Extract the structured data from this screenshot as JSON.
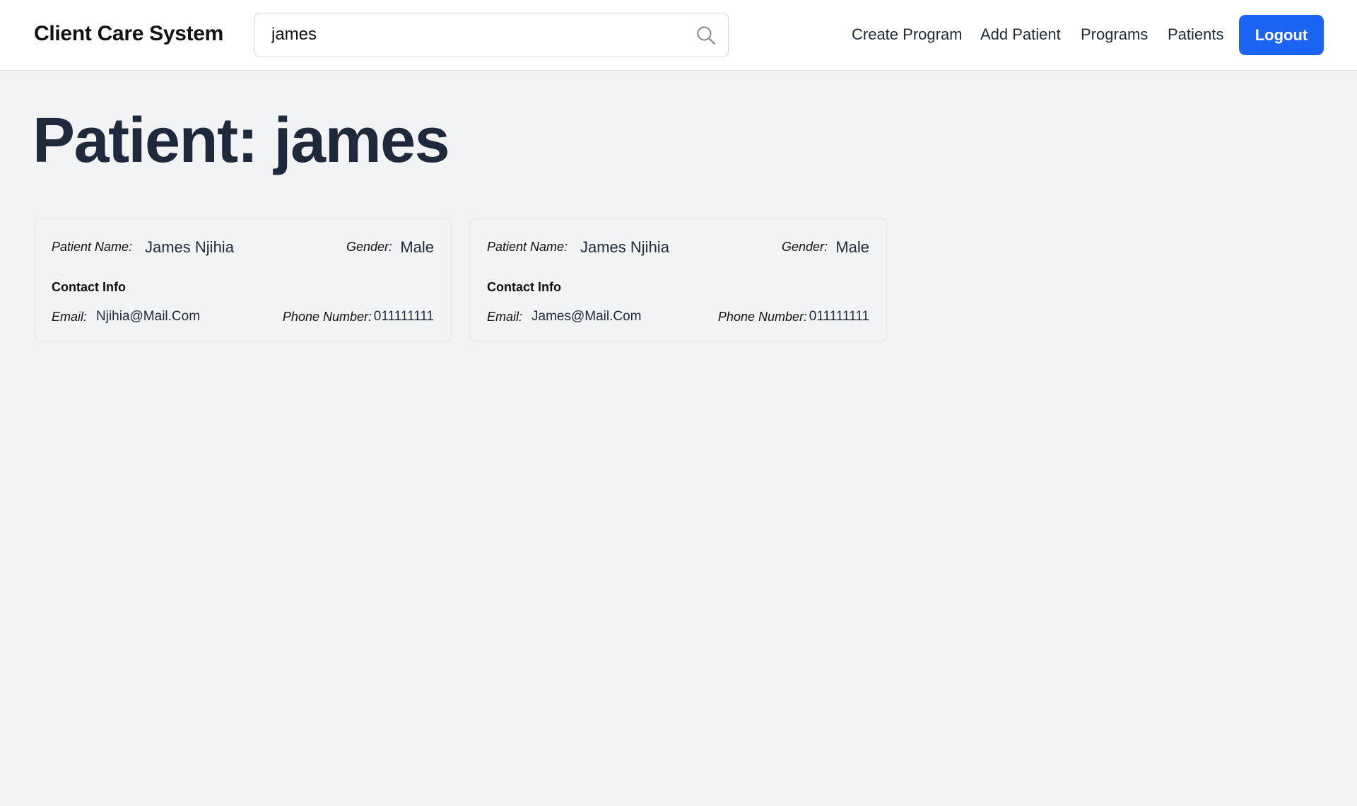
{
  "app": {
    "title": "Client Care System"
  },
  "search": {
    "value": "james",
    "icon": "search-icon"
  },
  "nav": {
    "create_program": "Create Program",
    "add_patient": "Add Patient",
    "programs": "Programs",
    "patients": "Patients",
    "logout": "Logout"
  },
  "colors": {
    "accent": "#1a63f5",
    "background": "#f2f3f5",
    "title_text": "#1e2a3b"
  },
  "page": {
    "title": "Patient: james"
  },
  "patients": [
    {
      "name_label": "Patient Name:",
      "name": "James Njihia",
      "gender_label": "Gender:",
      "gender": "Male",
      "contact_heading": "Contact Info",
      "email_label": "Email:",
      "email": "Njihia@Mail.Com",
      "phone_label": "Phone Number:",
      "phone": "011111111"
    },
    {
      "name_label": "Patient Name:",
      "name": "James Njihia",
      "gender_label": "Gender:",
      "gender": "Male",
      "contact_heading": "Contact Info",
      "email_label": "Email:",
      "email": "James@Mail.Com",
      "phone_label": "Phone Number:",
      "phone": "011111111"
    }
  ]
}
